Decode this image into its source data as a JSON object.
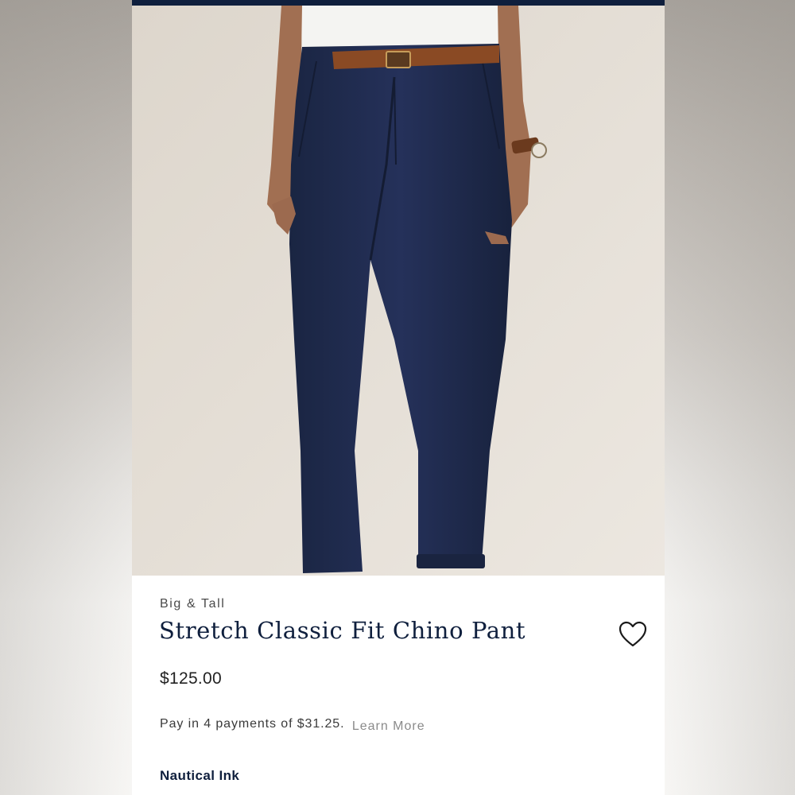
{
  "product": {
    "category": "Big & Tall",
    "title": "Stretch Classic Fit Chino Pant",
    "price": "$125.00",
    "installments_text": "Pay in 4 payments of $31.25.",
    "learn_more_label": "Learn More",
    "color_name": "Nautical Ink"
  },
  "icons": {
    "wishlist": "heart-outline-icon"
  },
  "colors": {
    "brand_navy": "#0f1f3d",
    "pant_navy": "#1f2a4a",
    "background_beige": "#e4ded5",
    "belt_brown": "#8a4a24"
  }
}
